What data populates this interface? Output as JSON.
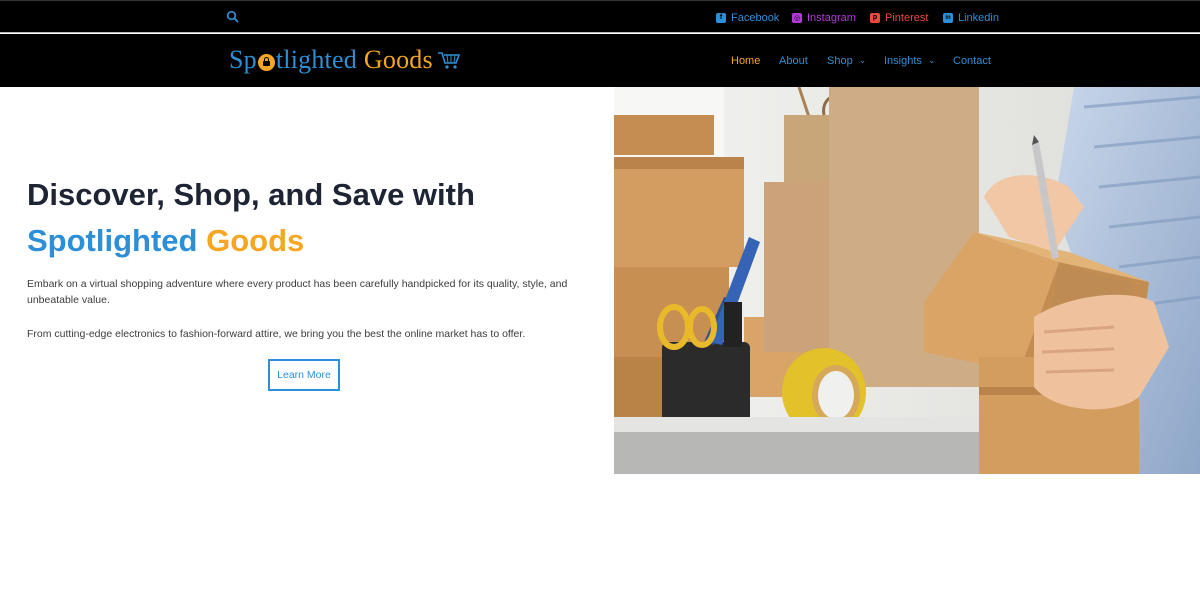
{
  "topbar": {
    "social": [
      {
        "label": "Facebook",
        "icon": "facebook-icon",
        "color": "#2d8fd5",
        "glyph": "f"
      },
      {
        "label": "Instagram",
        "icon": "instagram-icon",
        "color": "#b23bd8",
        "glyph": "◎"
      },
      {
        "label": "Pinterest",
        "icon": "pinterest-icon",
        "color": "#e74c3c",
        "glyph": "p"
      },
      {
        "label": "Linkedin",
        "icon": "linkedin-icon",
        "color": "#2d8fd5",
        "glyph": "in"
      }
    ]
  },
  "header": {
    "logo": {
      "part1": "Sp",
      "part2": "tlighted",
      "part3": "Goods",
      "blue": "#2d8fd5",
      "orange": "#f5a623"
    },
    "nav": [
      {
        "label": "Home",
        "active": true
      },
      {
        "label": "About"
      },
      {
        "label": "Shop",
        "dropdown": true
      },
      {
        "label": "Insights",
        "dropdown": true
      },
      {
        "label": "Contact"
      }
    ],
    "nav_color": "#2d8fd5",
    "nav_active_color": "#f5a623"
  },
  "hero": {
    "title_line1": "Discover, Shop, and Save with",
    "title_blue": "Spotlighted",
    "title_orange": "Goods",
    "paragraph1": "Embark on a virtual shopping adventure where every product has been carefully handpicked for its quality, style, and unbeatable value.",
    "paragraph2": "From cutting-edge electronics to fashion-forward attire, we bring you the best the online market has to offer.",
    "button_label": "Learn More"
  }
}
